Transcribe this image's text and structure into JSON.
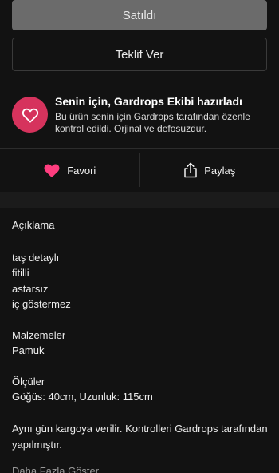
{
  "buttons": {
    "sold_label": "Satıldı",
    "offer_label": "Teklif Ver"
  },
  "curated": {
    "icon": "heart-outline-icon",
    "badge_color": "#d6335d",
    "title": "Senin için, Gardrops Ekibi hazırladı",
    "description": "Bu ürün senin için Gardrops tarafından özenle kontrol edildi. Orjinal ve defosuzdur."
  },
  "actions": {
    "favorite_label": "Favori",
    "favorite_icon": "heart-filled-icon",
    "favorite_color": "#ff3d7f",
    "share_label": "Paylaş",
    "share_icon": "share-icon"
  },
  "description": {
    "heading": "Açıklama",
    "tags": [
      "taş detaylı",
      "fitilli",
      "astarsız",
      "iç göstermez"
    ],
    "material_heading": "Malzemeler",
    "material_value": "Pamuk",
    "size_heading": "Ölçüler",
    "size_value": "Göğüs: 40cm, Uzunluk: 115cm",
    "shipping_text": "Aynı gün kargoya verilir. Kontrolleri Gardrops tarafından yapılmıştır.",
    "show_more_label": "Daha Fazla Göster"
  }
}
